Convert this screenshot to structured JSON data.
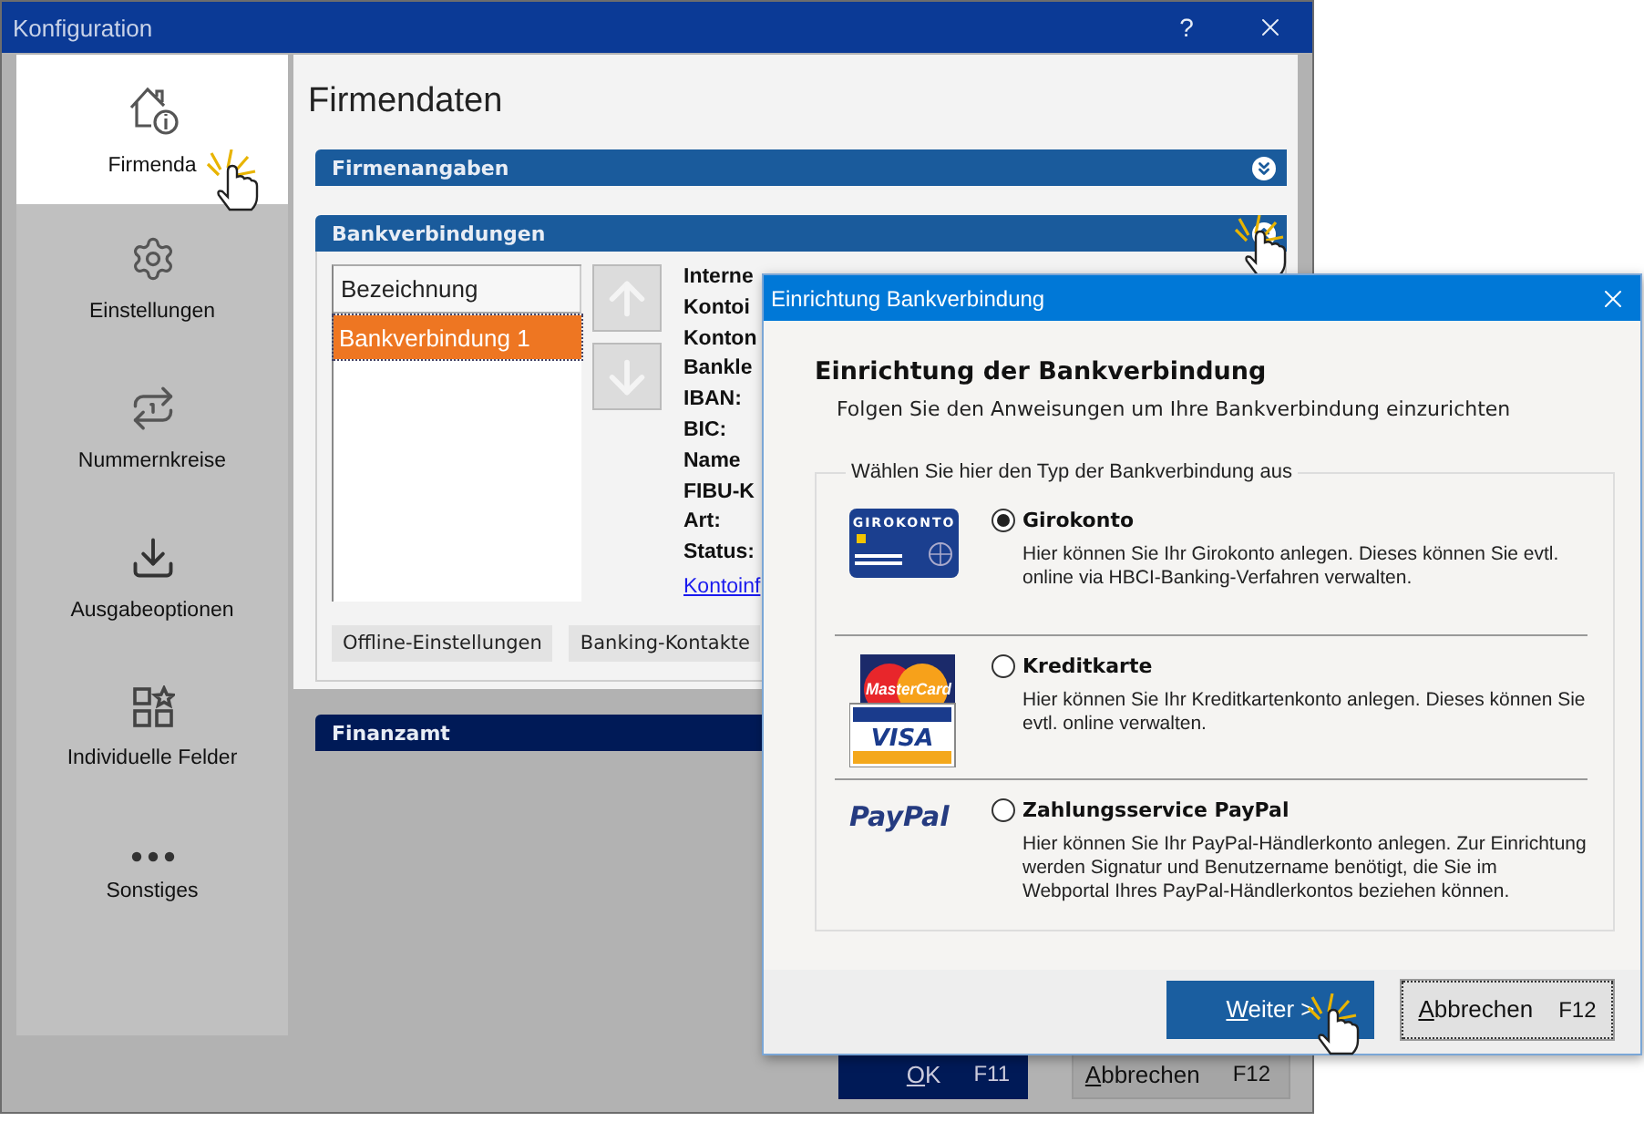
{
  "window": {
    "title": "Konfiguration",
    "help": "?"
  },
  "sidebar": {
    "items": [
      {
        "kind": "house",
        "label": "Firmenda",
        "selected": true
      },
      {
        "kind": "gear",
        "label": "Einstellungen",
        "selected": false
      },
      {
        "kind": "counter",
        "label": "Nummernkreise",
        "selected": false
      },
      {
        "kind": "download",
        "label": "Ausgabeoptionen",
        "selected": false
      },
      {
        "kind": "grid",
        "label": "Individuelle Felder",
        "selected": false
      },
      {
        "kind": "dots",
        "label": "Sonstiges",
        "selected": false
      }
    ]
  },
  "page": {
    "heading": "Firmendaten",
    "sections": [
      {
        "title": "Firmenangaben",
        "expanded": false,
        "active": false
      },
      {
        "title": "Bankverbindungen",
        "expanded": true,
        "active": false
      },
      {
        "title": "Finanzamt",
        "active": true
      }
    ],
    "bank_list": {
      "header": "Bezeichnung",
      "rows": [
        {
          "label": "Bankverbindung 1",
          "selected": true
        }
      ]
    },
    "field_labels": [
      "Interne",
      "Kontoi",
      "Konton",
      "Bankle",
      "IBAN:",
      "BIC:",
      "Name",
      "FIBU-K",
      "Art:",
      "Status:"
    ],
    "link": "Kontoinf",
    "bank_buttons": [
      "Offline-Einstellungen",
      "Banking-Kontakte"
    ]
  },
  "footer": {
    "buttons": [
      {
        "label": "OK",
        "shortcut": "F11",
        "primary": true
      },
      {
        "label": "Abbrechen",
        "shortcut": "F12",
        "primary": false
      }
    ]
  },
  "dialog": {
    "title": "Einrichtung Bankverbindung",
    "heading": "Einrichtung der Bankverbindung",
    "subtitle": "Folgen Sie den Anweisungen um Ihre Bankverbindung einzurichten",
    "group_label": "Wählen Sie hier den Typ der Bankverbindung aus",
    "options": [
      {
        "kind": "giro",
        "logo_text": [
          "GIROKONTO"
        ],
        "label": "Girokonto",
        "description": "Hier können Sie Ihr Girokonto anlegen. Dieses können Sie evtl. online via HBCI-Banking-Verfahren verwalten.",
        "selected": true
      },
      {
        "kind": "credit",
        "logo_text": [
          "MasterCard",
          "VISA"
        ],
        "label": "Kreditkarte",
        "description": "Hier können Sie Ihr Kreditkartenkonto anlegen. Dieses können Sie evtl. online verwalten.",
        "selected": false
      },
      {
        "kind": "paypal",
        "logo_text": [
          "PayPal"
        ],
        "label": "Zahlungsservice PayPal",
        "description": "Hier können Sie Ihr PayPal-Händlerkonto anlegen. Zur Einrichtung werden Signatur und Benutzername benötigt, die Sie im Webportal Ihres PayPal-Händlerkontos beziehen können.",
        "selected": false
      }
    ],
    "buttons": [
      {
        "label": "Weiter >",
        "primary": true
      },
      {
        "label": "Abbrechen",
        "shortcut": "F12",
        "primary": false
      }
    ]
  }
}
